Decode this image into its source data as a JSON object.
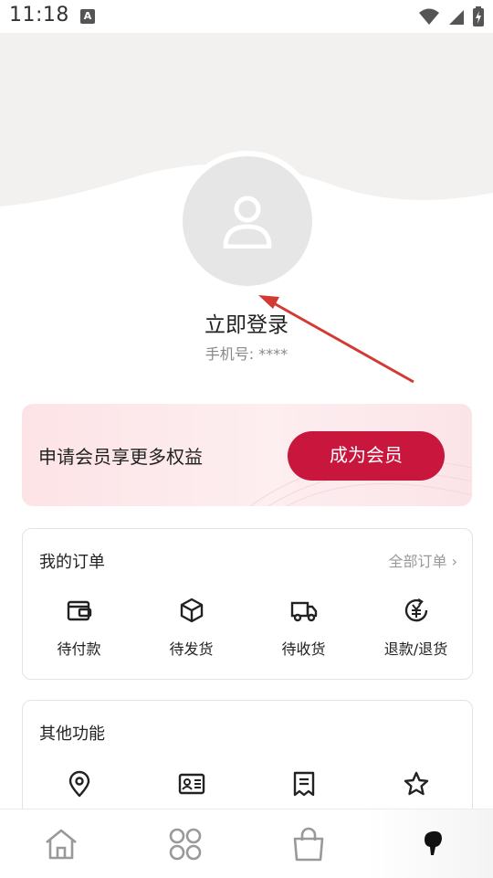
{
  "status_bar": {
    "time": "11:18",
    "notification_letter": "A"
  },
  "profile": {
    "login_title": "立即登录",
    "phone_label": "手机号: ****"
  },
  "membership": {
    "text": "申请会员享更多权益",
    "button_label": "成为会员"
  },
  "orders": {
    "title": "我的订单",
    "all_link": "全部订单 ›",
    "items": [
      {
        "label": "待付款",
        "icon": "wallet-icon"
      },
      {
        "label": "待发货",
        "icon": "package-icon"
      },
      {
        "label": "待收货",
        "icon": "truck-icon"
      },
      {
        "label": "退款/退货",
        "icon": "refund-icon"
      }
    ]
  },
  "other_functions": {
    "title": "其他功能",
    "items": [
      {
        "icon": "location-icon"
      },
      {
        "icon": "id-card-icon"
      },
      {
        "icon": "receipt-icon"
      },
      {
        "icon": "star-icon"
      }
    ]
  },
  "tabbar": {
    "items": [
      {
        "icon": "home-icon"
      },
      {
        "icon": "category-icon"
      },
      {
        "icon": "bag-icon"
      },
      {
        "icon": "profile-icon",
        "active": true
      }
    ]
  },
  "colors": {
    "accent": "#c8163d",
    "header_bg": "#f2f1f0"
  }
}
